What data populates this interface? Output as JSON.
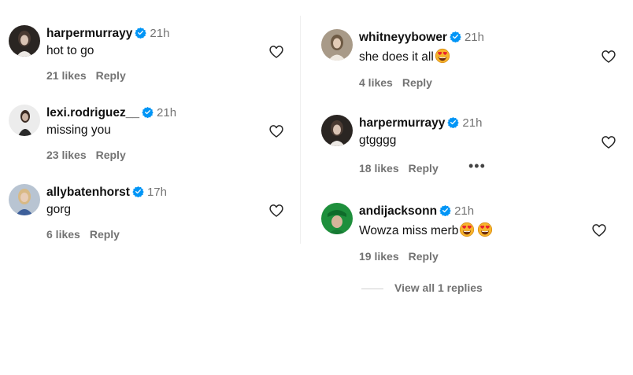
{
  "colors": {
    "verified": "#0095f6",
    "muted": "#737373",
    "text": "#111111"
  },
  "comments_left": [
    {
      "username": "harpermurrayy",
      "time": "21h",
      "text": "hot to go",
      "likes": "21 likes",
      "reply": "Reply"
    },
    {
      "username": "lexi.rodriguez__",
      "time": "21h",
      "text": "missing you",
      "likes": "23 likes",
      "reply": "Reply"
    },
    {
      "username": "allybatenhorst",
      "time": "17h",
      "text": "gorg",
      "likes": "6 likes",
      "reply": "Reply"
    }
  ],
  "comments_right": [
    {
      "username": "whitneyybower",
      "time": "21h",
      "text": "she does it all",
      "likes": "4 likes",
      "reply": "Reply",
      "emoji": "heart-eyes-emoji"
    },
    {
      "username": "harpermurrayy",
      "time": "21h",
      "text": "gtgggg",
      "likes": "18 likes",
      "reply": "Reply",
      "more": "•••"
    },
    {
      "username": "andijacksonn",
      "time": "21h",
      "text": "Wowza miss merb",
      "likes": "19 likes",
      "reply": "Reply",
      "emoji": "heart-eyes-emoji"
    }
  ],
  "view_replies": "View all 1 replies"
}
